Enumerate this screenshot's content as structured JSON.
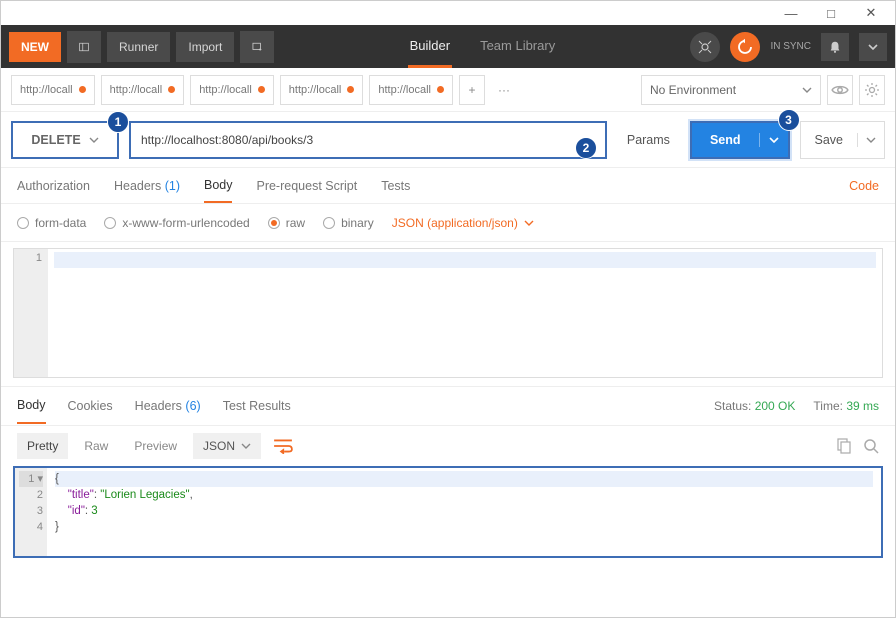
{
  "titlebar": {
    "min": "—",
    "max": "□",
    "close": "✕"
  },
  "toolbar": {
    "new": "NEW",
    "runner": "Runner",
    "import": "Import",
    "tabs": {
      "builder": "Builder",
      "team": "Team Library"
    },
    "sync": "IN SYNC"
  },
  "request_tabs": [
    {
      "label": "http://locall"
    },
    {
      "label": "http://locall"
    },
    {
      "label": "http://locall"
    },
    {
      "label": "http://locall"
    },
    {
      "label": "http://locall"
    }
  ],
  "tabs_more": "···",
  "env": {
    "placeholder": "No Environment"
  },
  "request": {
    "method": "DELETE",
    "url": "http://localhost:8080/api/books/3",
    "params": "Params",
    "send": "Send",
    "save": "Save"
  },
  "subtabs": {
    "auth": "Authorization",
    "headers": "Headers",
    "headers_count": "(1)",
    "body": "Body",
    "prereq": "Pre-request Script",
    "tests": "Tests",
    "code": "Code"
  },
  "body_options": {
    "form": "form-data",
    "url": "x-www-form-urlencoded",
    "raw": "raw",
    "binary": "binary",
    "ctype": "JSON (application/json)"
  },
  "request_body": {
    "line1": "1"
  },
  "response_tabs": {
    "body": "Body",
    "cookies": "Cookies",
    "headers": "Headers",
    "headers_count": "(6)",
    "tests": "Test Results"
  },
  "status": {
    "label": "Status:",
    "code": "200 OK",
    "time_label": "Time:",
    "time": "39 ms"
  },
  "format": {
    "pretty": "Pretty",
    "raw": "Raw",
    "preview": "Preview",
    "type": "JSON"
  },
  "response_body": {
    "gutter": [
      "1 ▾",
      "2",
      "3",
      "4"
    ],
    "l1": "{",
    "l2_key": "\"title\"",
    "l2_sep": ": ",
    "l2_val": "\"Lorien Legacies\"",
    "l2_end": ",",
    "l3_key": "\"id\"",
    "l3_sep": ": ",
    "l3_val": "3",
    "l4": "}"
  },
  "callouts": {
    "c1": "1",
    "c2": "2",
    "c3": "3"
  }
}
